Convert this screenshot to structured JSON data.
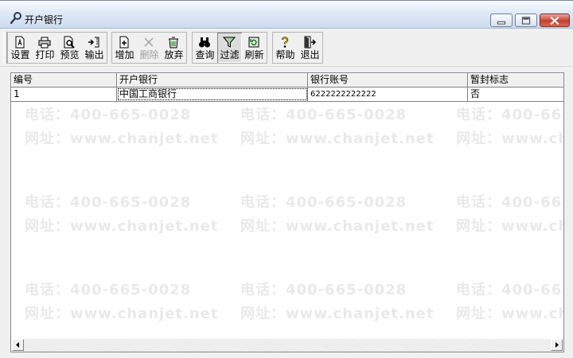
{
  "window": {
    "title": "开户银行",
    "controls": [
      "minimize",
      "maximize",
      "close"
    ]
  },
  "toolbar": {
    "groups": [
      [
        {
          "label": "设置",
          "icon": "page-setup-icon",
          "enabled": true
        },
        {
          "label": "打印",
          "icon": "printer-icon",
          "enabled": true
        },
        {
          "label": "预览",
          "icon": "print-preview-icon",
          "enabled": true
        },
        {
          "label": "输出",
          "icon": "export-icon",
          "enabled": true
        }
      ],
      [
        {
          "label": "增加",
          "icon": "add-document-icon",
          "enabled": true
        },
        {
          "label": "删除",
          "icon": "delete-x-icon",
          "enabled": false
        },
        {
          "label": "放弃",
          "icon": "discard-icon",
          "enabled": true
        }
      ],
      [
        {
          "label": "查询",
          "icon": "binoculars-icon",
          "enabled": true
        },
        {
          "label": "过滤",
          "icon": "filter-funnel-icon",
          "enabled": true,
          "pressed": true
        },
        {
          "label": "刷新",
          "icon": "refresh-icon",
          "enabled": true
        }
      ],
      [
        {
          "label": "帮助",
          "icon": "help-question-icon",
          "enabled": true
        },
        {
          "label": "退出",
          "icon": "exit-door-icon",
          "enabled": true
        }
      ]
    ]
  },
  "grid": {
    "columns": [
      "编号",
      "开户银行",
      "银行账号",
      "暂封标志"
    ],
    "rows": [
      [
        "1",
        "中国工商银行",
        "6222222222222",
        "否"
      ]
    ]
  },
  "watermark": {
    "phone": "电话：400-665-0028",
    "site": "网址：www.chanjet.net",
    "color": "#787878"
  },
  "colors": {
    "titlebar_top": "#f8fbff",
    "titlebar_bottom": "#cddbee",
    "close_button": "#c4412f",
    "disabled_text": "#a0a0a0"
  }
}
